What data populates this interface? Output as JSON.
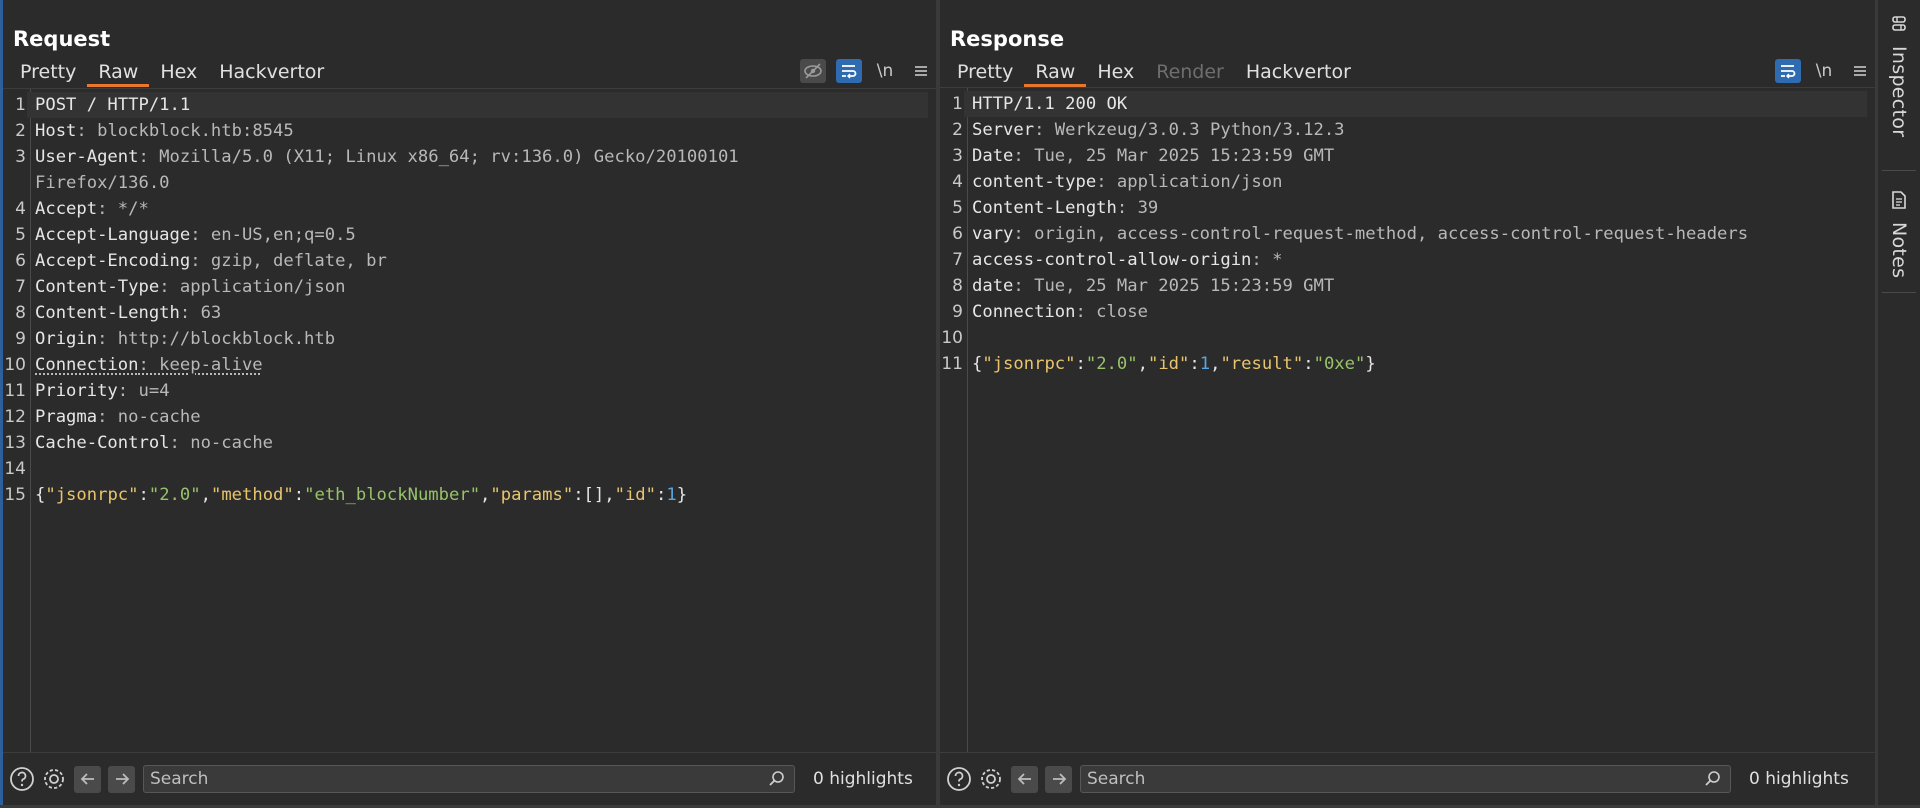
{
  "request": {
    "title": "Request",
    "tabs": [
      {
        "label": "Pretty",
        "active": false
      },
      {
        "label": "Raw",
        "active": true
      },
      {
        "label": "Hex",
        "active": false
      },
      {
        "label": "Hackvertor",
        "active": false
      }
    ],
    "toolbar": {
      "newline_label": "\\n"
    },
    "lines": [
      {
        "n": "1",
        "parts": [
          {
            "t": "POST / HTTP/1.1",
            "c": "hk"
          }
        ]
      },
      {
        "n": "2",
        "parts": [
          {
            "t": "Host",
            "c": "hk"
          },
          {
            "t": ": blockblock.htb:8545",
            "c": "hv"
          }
        ]
      },
      {
        "n": "3",
        "parts": [
          {
            "t": "User-Agent",
            "c": "hk"
          },
          {
            "t": ": Mozilla/5.0 (X11; Linux x86_64; rv:136.0) Gecko/20100101",
            "c": "hv"
          }
        ]
      },
      {
        "n": "",
        "parts": [
          {
            "t": "Firefox/136.0",
            "c": "hv"
          }
        ]
      },
      {
        "n": "4",
        "parts": [
          {
            "t": "Accept",
            "c": "hk"
          },
          {
            "t": ": */*",
            "c": "hv"
          }
        ]
      },
      {
        "n": "5",
        "parts": [
          {
            "t": "Accept-Language",
            "c": "hk"
          },
          {
            "t": ": en-US,en;q=0.5",
            "c": "hv"
          }
        ]
      },
      {
        "n": "6",
        "parts": [
          {
            "t": "Accept-Encoding",
            "c": "hk"
          },
          {
            "t": ": gzip, deflate, br",
            "c": "hv"
          }
        ]
      },
      {
        "n": "7",
        "parts": [
          {
            "t": "Content-Type",
            "c": "hk"
          },
          {
            "t": ": application/json",
            "c": "hv"
          }
        ]
      },
      {
        "n": "8",
        "parts": [
          {
            "t": "Content-Length",
            "c": "hk"
          },
          {
            "t": ": 63",
            "c": "hv"
          }
        ]
      },
      {
        "n": "9",
        "parts": [
          {
            "t": "Origin",
            "c": "hk"
          },
          {
            "t": ": http://blockblock.htb",
            "c": "hv"
          }
        ]
      },
      {
        "n": "10",
        "parts": [
          {
            "t": "Connection",
            "c": "hk ul"
          },
          {
            "t": ": keep-alive",
            "c": "hv ul"
          }
        ]
      },
      {
        "n": "11",
        "parts": [
          {
            "t": "Priority",
            "c": "hk"
          },
          {
            "t": ": u=4",
            "c": "hv"
          }
        ]
      },
      {
        "n": "12",
        "parts": [
          {
            "t": "Pragma",
            "c": "hk"
          },
          {
            "t": ": no-cache",
            "c": "hv"
          }
        ]
      },
      {
        "n": "13",
        "parts": [
          {
            "t": "Cache-Control",
            "c": "hk"
          },
          {
            "t": ": no-cache",
            "c": "hv"
          }
        ]
      },
      {
        "n": "14",
        "parts": []
      },
      {
        "n": "15",
        "parts": [
          {
            "t": "{",
            "c": "jp"
          },
          {
            "t": "\"jsonrpc\"",
            "c": "jk"
          },
          {
            "t": ":",
            "c": "jp"
          },
          {
            "t": "\"2.0\"",
            "c": "js"
          },
          {
            "t": ",",
            "c": "jp"
          },
          {
            "t": "\"method\"",
            "c": "jk"
          },
          {
            "t": ":",
            "c": "jp"
          },
          {
            "t": "\"eth_blockNumber\"",
            "c": "js"
          },
          {
            "t": ",",
            "c": "jp"
          },
          {
            "t": "\"params\"",
            "c": "jk"
          },
          {
            "t": ":[],",
            "c": "jp"
          },
          {
            "t": "\"id\"",
            "c": "jk"
          },
          {
            "t": ":",
            "c": "jp"
          },
          {
            "t": "1",
            "c": "jn"
          },
          {
            "t": "}",
            "c": "jp"
          }
        ]
      }
    ],
    "search_placeholder": "Search",
    "highlights": "0 highlights"
  },
  "response": {
    "title": "Response",
    "tabs": [
      {
        "label": "Pretty",
        "active": false
      },
      {
        "label": "Raw",
        "active": true
      },
      {
        "label": "Hex",
        "active": false
      },
      {
        "label": "Render",
        "active": false,
        "disabled": true
      },
      {
        "label": "Hackvertor",
        "active": false
      }
    ],
    "toolbar": {
      "newline_label": "\\n"
    },
    "lines": [
      {
        "n": "1",
        "parts": [
          {
            "t": "HTTP/1.1 200 OK",
            "c": "hk"
          }
        ]
      },
      {
        "n": "2",
        "parts": [
          {
            "t": "Server",
            "c": "hk"
          },
          {
            "t": ": Werkzeug/3.0.3 Python/3.12.3",
            "c": "hv"
          }
        ]
      },
      {
        "n": "3",
        "parts": [
          {
            "t": "Date",
            "c": "hk"
          },
          {
            "t": ": Tue, 25 Mar 2025 15:23:59 GMT",
            "c": "hv"
          }
        ]
      },
      {
        "n": "4",
        "parts": [
          {
            "t": "content-type",
            "c": "hk"
          },
          {
            "t": ": application/json",
            "c": "hv"
          }
        ]
      },
      {
        "n": "5",
        "parts": [
          {
            "t": "Content-Length",
            "c": "hk"
          },
          {
            "t": ": 39",
            "c": "hv"
          }
        ]
      },
      {
        "n": "6",
        "parts": [
          {
            "t": "vary",
            "c": "hk"
          },
          {
            "t": ": origin, access-control-request-method, access-control-request-headers",
            "c": "hv"
          }
        ]
      },
      {
        "n": "7",
        "parts": [
          {
            "t": "access-control-allow-origin",
            "c": "hk"
          },
          {
            "t": ": *",
            "c": "hv"
          }
        ]
      },
      {
        "n": "8",
        "parts": [
          {
            "t": "date",
            "c": "hk"
          },
          {
            "t": ": Tue, 25 Mar 2025 15:23:59 GMT",
            "c": "hv"
          }
        ]
      },
      {
        "n": "9",
        "parts": [
          {
            "t": "Connection",
            "c": "hk"
          },
          {
            "t": ": close",
            "c": "hv"
          }
        ]
      },
      {
        "n": "10",
        "parts": []
      },
      {
        "n": "11",
        "parts": [
          {
            "t": "{",
            "c": "jp"
          },
          {
            "t": "\"jsonrpc\"",
            "c": "jk"
          },
          {
            "t": ":",
            "c": "jp"
          },
          {
            "t": "\"2.0\"",
            "c": "js"
          },
          {
            "t": ",",
            "c": "jp"
          },
          {
            "t": "\"id\"",
            "c": "jk"
          },
          {
            "t": ":",
            "c": "jp"
          },
          {
            "t": "1",
            "c": "jn"
          },
          {
            "t": ",",
            "c": "jp"
          },
          {
            "t": "\"result\"",
            "c": "jk"
          },
          {
            "t": ":",
            "c": "jp"
          },
          {
            "t": "\"0xe\"",
            "c": "js"
          },
          {
            "t": "}",
            "c": "jp"
          }
        ]
      }
    ],
    "search_placeholder": "Search",
    "highlights": "0 highlights"
  },
  "sidebar": {
    "inspector_label": "Inspector",
    "notes_label": "Notes"
  },
  "colors": {
    "accent_tab": "#e8772e",
    "toggle_on": "#2e6bb0",
    "json_key": "#e8c46c",
    "json_string": "#98c36a",
    "json_number": "#5aa6e0"
  }
}
